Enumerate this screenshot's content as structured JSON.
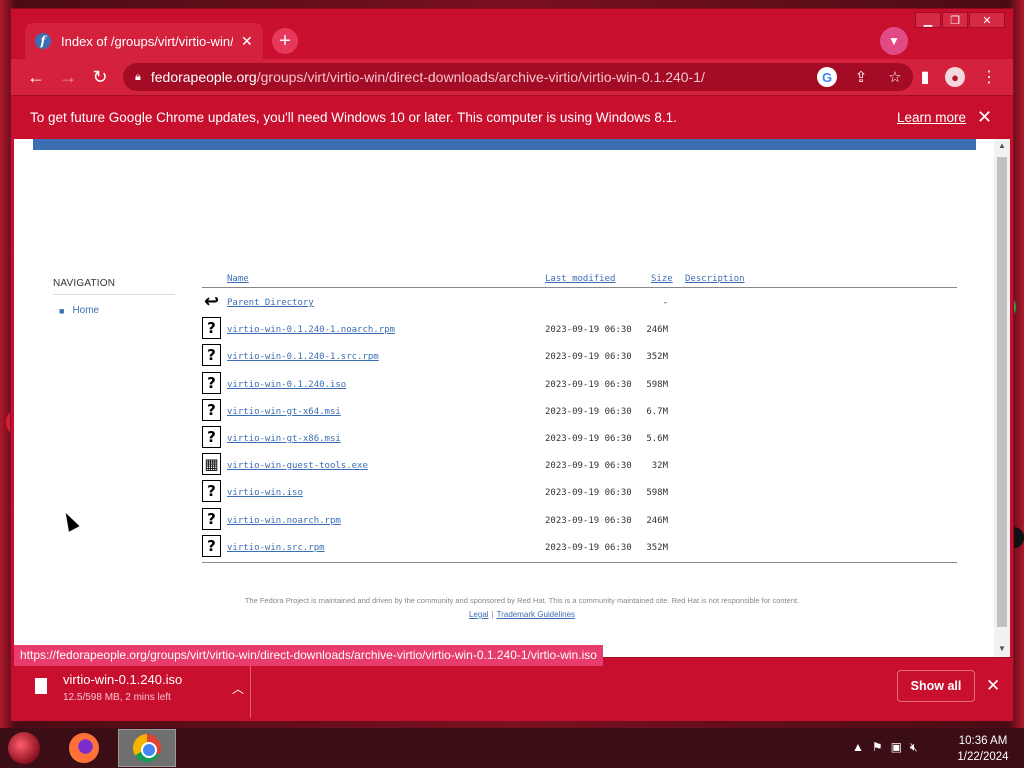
{
  "browser": {
    "tab": {
      "title": "Index of /groups/virt/virtio-win/d",
      "favicon": "fedora-icon"
    },
    "new_tab": "+",
    "url_host": "fedorapeople.org",
    "url_path": "/groups/virt/virtio-win/direct-downloads/archive-virtio/virtio-win-0.1.240-1/",
    "infobar": {
      "message": "To get future Google Chrome updates, you'll need Windows 10 or later. This computer is using Windows 8.1.",
      "link": "Learn more"
    },
    "status_url": "https://fedorapeople.org/groups/virt/virtio-win/direct-downloads/archive-virtio/virtio-win-0.1.240-1/virtio-win.iso"
  },
  "page": {
    "navigation": {
      "title": "NAVIGATION",
      "items": [
        "Home"
      ]
    },
    "headers": {
      "name": "Name",
      "modified": "Last modified",
      "size": "Size",
      "description": "Description"
    },
    "rows": [
      {
        "icon": "back-icon",
        "name": "Parent Directory",
        "date": "",
        "size": "-"
      },
      {
        "icon": "unknown-file-icon",
        "name": "virtio-win-0.1.240-1.noarch.rpm",
        "date": "2023-09-19 06:30",
        "size": "246M"
      },
      {
        "icon": "unknown-file-icon",
        "name": "virtio-win-0.1.240-1.src.rpm",
        "date": "2023-09-19 06:30",
        "size": "352M"
      },
      {
        "icon": "unknown-file-icon",
        "name": "virtio-win-0.1.240.iso",
        "date": "2023-09-19 06:30",
        "size": "598M"
      },
      {
        "icon": "unknown-file-icon",
        "name": "virtio-win-gt-x64.msi",
        "date": "2023-09-19 06:30",
        "size": "6.7M"
      },
      {
        "icon": "unknown-file-icon",
        "name": "virtio-win-gt-x86.msi",
        "date": "2023-09-19 06:30",
        "size": "5.6M"
      },
      {
        "icon": "binary-file-icon",
        "name": "virtio-win-guest-tools.exe",
        "date": "2023-09-19 06:30",
        "size": "32M"
      },
      {
        "icon": "unknown-file-icon",
        "name": "virtio-win.iso",
        "date": "2023-09-19 06:30",
        "size": "598M"
      },
      {
        "icon": "unknown-file-icon",
        "name": "virtio-win.noarch.rpm",
        "date": "2023-09-19 06:30",
        "size": "246M"
      },
      {
        "icon": "unknown-file-icon",
        "name": "virtio-win.src.rpm",
        "date": "2023-09-19 06:30",
        "size": "352M"
      }
    ],
    "footer": {
      "text": "The Fedora Project is maintained and driven by the community and sponsored by Red Hat. This is a community maintained site. Red Hat is not responsible for content.",
      "links": [
        "Legal",
        "Trademark Guidelines"
      ],
      "separator": "|"
    }
  },
  "downloads": {
    "file_name": "virtio-win-0.1.240.iso",
    "status": "12.5/598 MB, 2 mins left",
    "show_all": "Show all"
  },
  "taskbar": {
    "time": "10:36 AM",
    "date": "1/22/2024"
  },
  "colors": {
    "chrome_theme": "#c8102e",
    "fedora_blue": "#3c6eb4",
    "link": "#3c6eb4"
  }
}
